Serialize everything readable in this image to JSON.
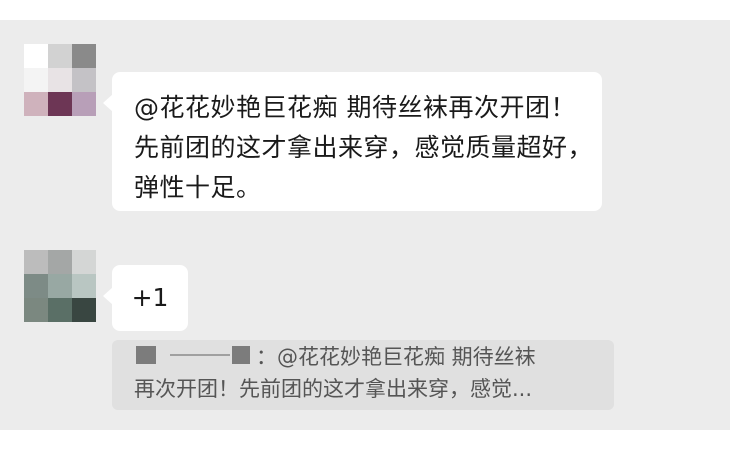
{
  "chat": {
    "messages": [
      {
        "sender": "",
        "text": "@花花妙艳巨花痴 期待丝袜再次开团！先前团的这才拿出来穿，感觉质量超好，弹性十足。",
        "avatar_colors": [
          "#ffffff",
          "#d2d2d2",
          "#8a8a8a",
          "#f4f4f4",
          "#e8e3e5",
          "#c4c2c6",
          "#cfb2bc",
          "#6d3655",
          "#b89fb8"
        ]
      },
      {
        "sender": "",
        "text": "+1",
        "avatar_colors": [
          "#bcbcbc",
          "#a4a7a6",
          "#d4d6d5",
          "#7d8b86",
          "#98a8a3",
          "#b9c6c2",
          "#7b8880",
          "#5a6f66",
          "#394641"
        ]
      }
    ],
    "quote": {
      "prefix": "：",
      "line1": "@花花妙艳巨花痴 期待丝袜",
      "line2": "再次开团！先前团的这才拿出来穿，感觉..."
    }
  },
  "colors": {
    "chat_background": "#ececec",
    "bubble": "#ffffff",
    "quote_background": "#e0e0e0"
  }
}
